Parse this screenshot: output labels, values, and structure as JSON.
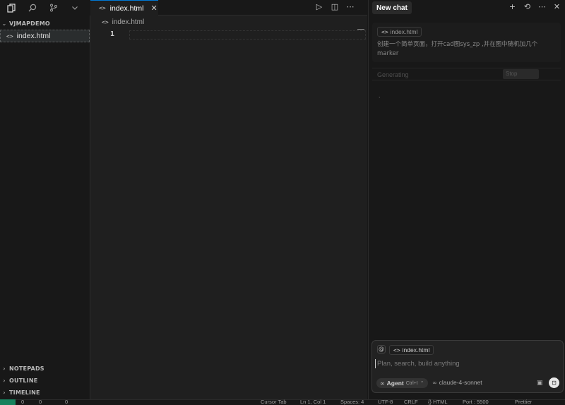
{
  "activity_bar": {
    "icons": [
      "files-icon",
      "search-icon",
      "source-control-icon",
      "chevron-down-icon"
    ]
  },
  "sidebar": {
    "project": "VJMAPDEMO",
    "files": [
      {
        "name": "index.html",
        "icon": "code-icon"
      }
    ],
    "sections": [
      "NOTEPADS",
      "OUTLINE",
      "TIMELINE"
    ]
  },
  "editor": {
    "tab_label": "index.html",
    "breadcrumb": "index.html",
    "line_number": "1",
    "actions": [
      "run-icon",
      "split-editor-icon",
      "more-icon"
    ]
  },
  "chat": {
    "header": "New chat",
    "message_chip": "index.html",
    "message_text": "创建一个简单页面，打开cad图sys_zp ,并在图中随机加几个marker",
    "status_label": "Generating",
    "stop_label": "Stop",
    "composer": {
      "context_chip": "index.html",
      "placeholder": "Plan, search, build anything",
      "agent_label": "Agent",
      "agent_shortcut": "Ctrl+I",
      "model": "claude-4-sonnet"
    }
  },
  "status_bar": {
    "errors": "0",
    "warnings": "0",
    "ports": "0",
    "items": [
      "Cursor Tab",
      "Ln 1, Col 1",
      "Spaces: 4",
      "UTF-8",
      "CRLF",
      "{} HTML",
      "Port : 5500",
      "Prettier"
    ]
  }
}
